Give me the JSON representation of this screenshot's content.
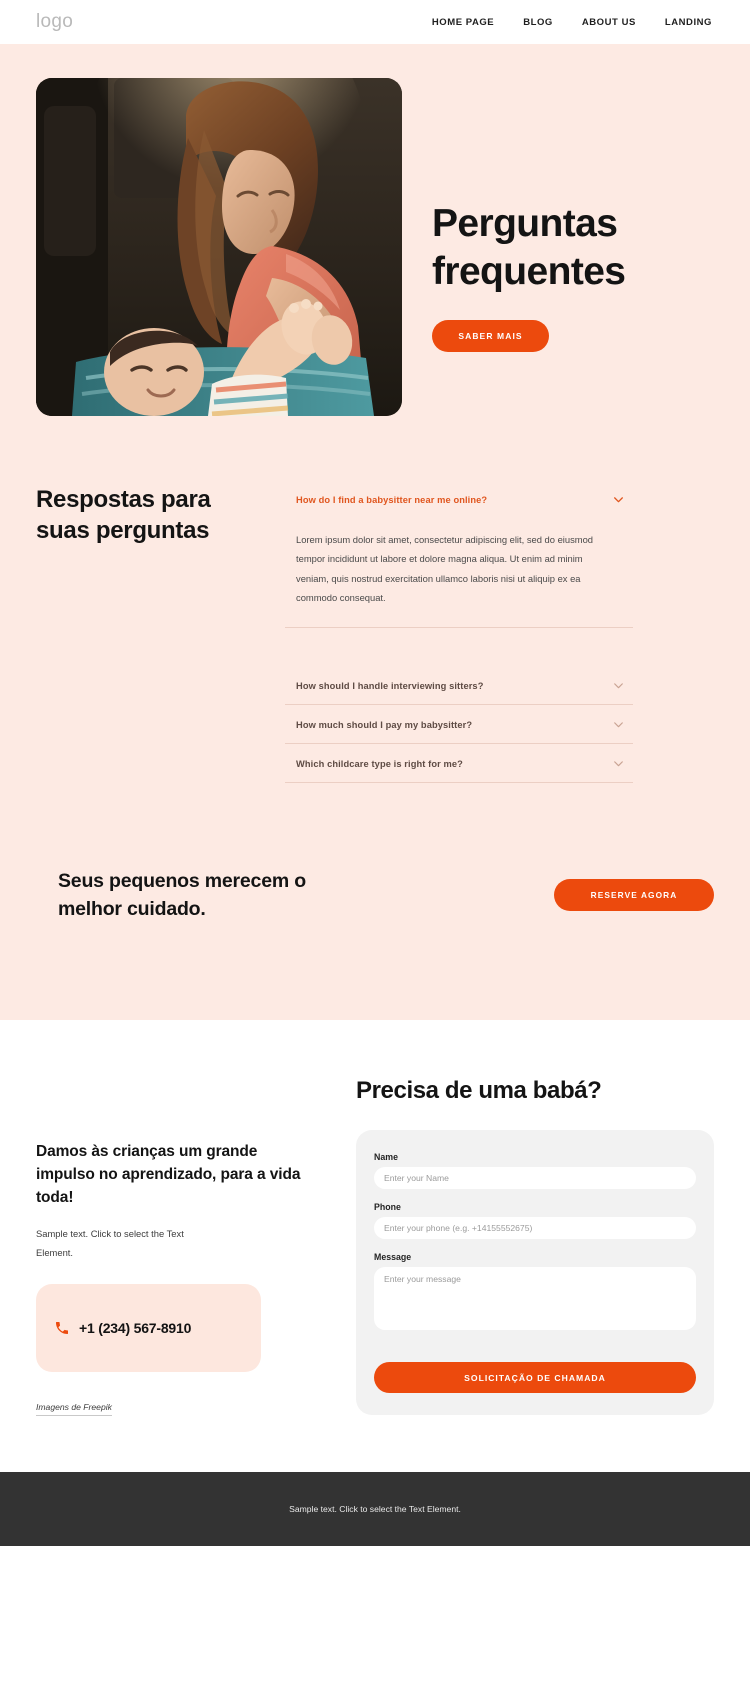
{
  "header": {
    "logo": "logo",
    "nav": [
      {
        "label": "HOME PAGE"
      },
      {
        "label": "BLOG"
      },
      {
        "label": "ABOUT US"
      },
      {
        "label": "LANDING"
      }
    ]
  },
  "hero": {
    "title": "Perguntas frequentes",
    "cta_label": "SABER MAIS",
    "image_alt": "mother-playing-with-baby-photo"
  },
  "faq": {
    "heading": "Respostas para suas perguntas",
    "items": [
      {
        "question": "How do I find a babysitter near me online?",
        "answer": "Lorem ipsum dolor sit amet, consectetur adipiscing elit, sed do eiusmod tempor incididunt ut labore et dolore magna aliqua. Ut enim ad minim veniam, quis nostrud exercitation ullamco laboris nisi ut aliquip ex ea commodo consequat.",
        "open": true
      },
      {
        "question": "How should I handle interviewing sitters?",
        "answer": "",
        "open": false
      },
      {
        "question": "How much should I pay my babysitter?",
        "answer": "",
        "open": false
      },
      {
        "question": "Which childcare type is right for me?",
        "answer": "",
        "open": false
      }
    ]
  },
  "cta": {
    "text": "Seus pequenos merecem o melhor cuidado.",
    "button_label": "RESERVE AGORA"
  },
  "contact": {
    "left_title": "Damos às crianças um grande impulso no aprendizado, para a vida toda!",
    "left_sub": "Sample text. Click to select the Text Element.",
    "phone": "+1 (234) 567-8910",
    "credit": "Imagens de Freepik",
    "form_title": "Precisa de uma babá?",
    "fields": {
      "name_label": "Name",
      "name_placeholder": "Enter your Name",
      "phone_label": "Phone",
      "phone_placeholder": "Enter your phone (e.g. +14155552675)",
      "message_label": "Message",
      "message_placeholder": "Enter your message"
    },
    "submit_label": "SOLICITAÇÃO DE CHAMADA"
  },
  "footer": {
    "text": "Sample text. Click to select the Text Element."
  },
  "colors": {
    "accent": "#ec4a0d",
    "pink_bg": "#fdeae3",
    "footer_bg": "#333333",
    "form_bg": "#f2f2f2"
  }
}
